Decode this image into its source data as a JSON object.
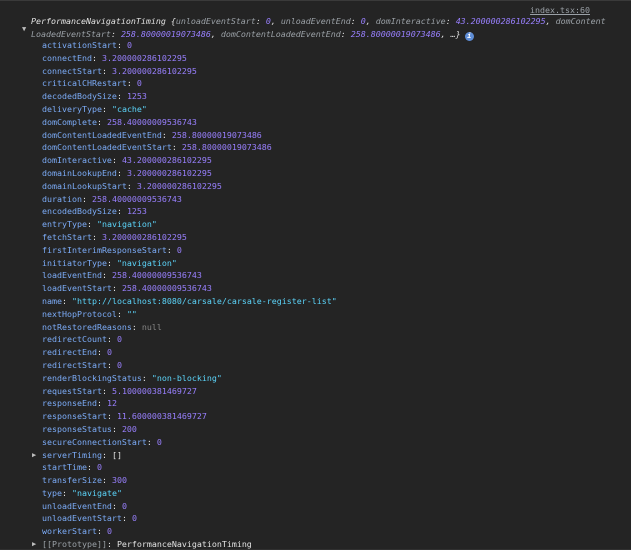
{
  "source_link": "index.tsx:60",
  "summary": {
    "type_name": "PerformanceNavigationTiming",
    "open_brace": "{",
    "preview": [
      {
        "key": "unloadEventStart",
        "value": "0"
      },
      {
        "key": "unloadEventEnd",
        "value": "0"
      },
      {
        "key": "domInteractive",
        "value": "43.200000286102295"
      },
      {
        "key": "domContentLoadedEventStart",
        "value": "258.80000019073486"
      },
      {
        "key": "domContentLoadedEventEnd",
        "value": "258.80000019073486"
      }
    ],
    "ellipsis": "…}",
    "info_badge": "i",
    "expand_icon": "triangle-down"
  },
  "properties": [
    {
      "key": "activationStart",
      "value": "0",
      "kind": "num"
    },
    {
      "key": "connectEnd",
      "value": "3.200000286102295",
      "kind": "num"
    },
    {
      "key": "connectStart",
      "value": "3.200000286102295",
      "kind": "num"
    },
    {
      "key": "criticalCHRestart",
      "value": "0",
      "kind": "num"
    },
    {
      "key": "decodedBodySize",
      "value": "1253",
      "kind": "num"
    },
    {
      "key": "deliveryType",
      "value": "\"cache\"",
      "kind": "str"
    },
    {
      "key": "domComplete",
      "value": "258.40000009536743",
      "kind": "num"
    },
    {
      "key": "domContentLoadedEventEnd",
      "value": "258.80000019073486",
      "kind": "num"
    },
    {
      "key": "domContentLoadedEventStart",
      "value": "258.80000019073486",
      "kind": "num"
    },
    {
      "key": "domInteractive",
      "value": "43.200000286102295",
      "kind": "num"
    },
    {
      "key": "domainLookupEnd",
      "value": "3.200000286102295",
      "kind": "num"
    },
    {
      "key": "domainLookupStart",
      "value": "3.200000286102295",
      "kind": "num"
    },
    {
      "key": "duration",
      "value": "258.40000009536743",
      "kind": "num"
    },
    {
      "key": "encodedBodySize",
      "value": "1253",
      "kind": "num"
    },
    {
      "key": "entryType",
      "value": "\"navigation\"",
      "kind": "str"
    },
    {
      "key": "fetchStart",
      "value": "3.200000286102295",
      "kind": "num"
    },
    {
      "key": "firstInterimResponseStart",
      "value": "0",
      "kind": "num"
    },
    {
      "key": "initiatorType",
      "value": "\"navigation\"",
      "kind": "str"
    },
    {
      "key": "loadEventEnd",
      "value": "258.40000009536743",
      "kind": "num"
    },
    {
      "key": "loadEventStart",
      "value": "258.40000009536743",
      "kind": "num"
    },
    {
      "key": "name",
      "value": "\"http://localhost:8080/carsale/carsale-register-list\"",
      "kind": "str"
    },
    {
      "key": "nextHopProtocol",
      "value": "\"\"",
      "kind": "str"
    },
    {
      "key": "notRestoredReasons",
      "value": "null",
      "kind": "null"
    },
    {
      "key": "redirectCount",
      "value": "0",
      "kind": "num"
    },
    {
      "key": "redirectEnd",
      "value": "0",
      "kind": "num"
    },
    {
      "key": "redirectStart",
      "value": "0",
      "kind": "num"
    },
    {
      "key": "renderBlockingStatus",
      "value": "\"non-blocking\"",
      "kind": "str"
    },
    {
      "key": "requestStart",
      "value": "5.100000381469727",
      "kind": "num"
    },
    {
      "key": "responseEnd",
      "value": "12",
      "kind": "num"
    },
    {
      "key": "responseStart",
      "value": "11.600000381469727",
      "kind": "num"
    },
    {
      "key": "responseStatus",
      "value": "200",
      "kind": "num"
    },
    {
      "key": "secureConnectionStart",
      "value": "0",
      "kind": "num"
    },
    {
      "key": "serverTiming",
      "value": "[]",
      "kind": "obj",
      "expandable": true
    },
    {
      "key": "startTime",
      "value": "0",
      "kind": "num"
    },
    {
      "key": "transferSize",
      "value": "300",
      "kind": "num"
    },
    {
      "key": "type",
      "value": "\"navigate\"",
      "kind": "str"
    },
    {
      "key": "unloadEventEnd",
      "value": "0",
      "kind": "num"
    },
    {
      "key": "unloadEventStart",
      "value": "0",
      "kind": "num"
    },
    {
      "key": "workerStart",
      "value": "0",
      "kind": "num"
    },
    {
      "key": "[[Prototype]]",
      "value": "PerformanceNavigationTiming",
      "kind": "obj",
      "expandable": true,
      "dim": true
    }
  ],
  "colors": {
    "background": "#242424",
    "key": "#7cacf8",
    "number": "#9980ff",
    "string": "#5cd5fb",
    "null": "#858585"
  }
}
